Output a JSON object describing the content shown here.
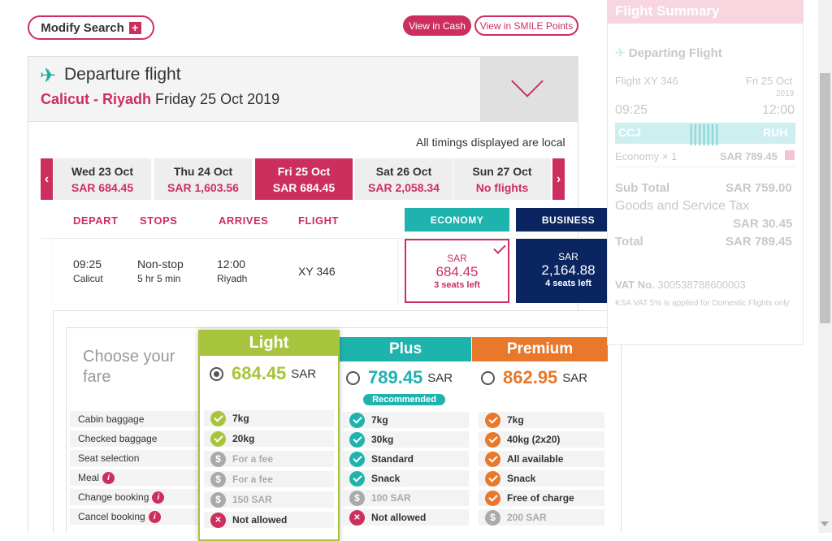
{
  "toolbar": {
    "modify_search": "Modify Search",
    "modify_plus": "+",
    "view_cash": "View in Cash",
    "view_points": "View in SMILE Points"
  },
  "departure": {
    "title": "Departure flight",
    "route": "Calicut - Riyadh",
    "date": "Friday 25 Oct 2019",
    "timings_note": "All timings displayed are local"
  },
  "date_tabs": [
    {
      "day": "Wed 23 Oct",
      "price": "SAR 684.45"
    },
    {
      "day": "Thu 24 Oct",
      "price": "SAR 1,603.56"
    },
    {
      "day": "Fri 25 Oct",
      "price": "SAR 684.45"
    },
    {
      "day": "Sat 26 Oct",
      "price": "SAR 2,058.34"
    },
    {
      "day": "Sun 27 Oct",
      "price": "No flights"
    }
  ],
  "columns": {
    "depart": "DEPART",
    "stops": "STOPS",
    "arrives": "ARRIVES",
    "flight": "FLIGHT",
    "economy": "ECONOMY",
    "business": "BUSINESS"
  },
  "flight": {
    "dep_time": "09:25",
    "dep_city": "Calicut",
    "stops": "Non-stop",
    "duration": "5 hr 5 min",
    "arr_time": "12:00",
    "arr_city": "Riyadh",
    "number": "XY 346",
    "economy": {
      "cur": "SAR",
      "amount": "684.45",
      "seats": "3 seats left"
    },
    "business": {
      "cur": "SAR",
      "amount": "2,164.88",
      "seats": "4 seats left"
    }
  },
  "fares": {
    "choose": "Choose your fare",
    "labels": [
      "Cabin baggage",
      "Checked baggage",
      "Seat selection",
      "Meal",
      "Change booking",
      "Cancel booking"
    ],
    "light": {
      "name": "Light",
      "price": "684.45",
      "cur": "SAR",
      "rows": [
        "7kg",
        "20kg",
        "For a fee",
        "For a fee",
        "150 SAR",
        "Not allowed"
      ]
    },
    "plus": {
      "name": "Plus",
      "price": "789.45",
      "cur": "SAR",
      "badge": "Recommended",
      "rows": [
        "7kg",
        "30kg",
        "Standard",
        "Snack",
        "100 SAR",
        "Not allowed"
      ]
    },
    "premium": {
      "name": "Premium",
      "price": "862.95",
      "cur": "SAR",
      "rows": [
        "7kg",
        "40kg (2x20)",
        "All available",
        "Snack",
        "Free of charge",
        "200 SAR"
      ]
    },
    "colors": {
      "light": "#a8c43c",
      "plus": "#1fb3ad",
      "premium": "#e8782a",
      "accent": "#cc2f5e"
    }
  },
  "summary": {
    "title": "Flight Summary",
    "departing": "Departing Flight",
    "flight": "Flight XY 346",
    "date": "Fri 25 Oct",
    "year": "2019",
    "dep_time": "09:25",
    "arr_time": "12:00",
    "from": "CCJ",
    "to": "RUH",
    "fare_line": "Economy × 1",
    "fare_price": "SAR 789.45",
    "subtotal_label": "Sub Total",
    "subtotal": "SAR 759.00",
    "gst_label": "Goods and Service Tax",
    "gst": "SAR 30.45",
    "total_label": "Total",
    "total": "SAR 789.45",
    "vat_label": "VAT No.",
    "vat_no": "300538788600003",
    "vat_note": "KSA VAT 5% is applied for Domestic Flights only"
  }
}
